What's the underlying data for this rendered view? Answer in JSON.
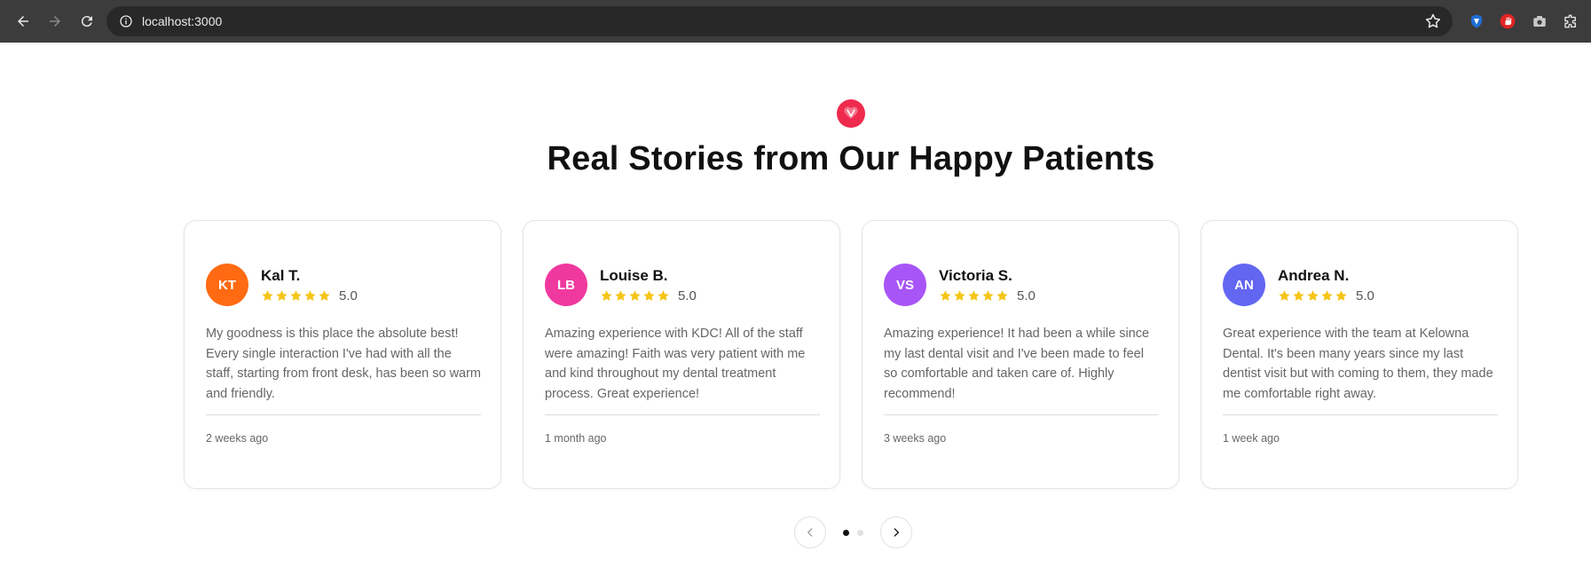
{
  "browser": {
    "url": "localhost:3000"
  },
  "section": {
    "heading": "Real Stories from Our Happy Patients",
    "accent_color": "#ef2b4d"
  },
  "reviews": [
    {
      "initials": "KT",
      "name": "Kal T.",
      "rating": 5,
      "score": "5.0",
      "avatar_color": "#ff6a13",
      "text": "My goodness is this place the absolute best! Every single interaction I've had with all the staff, starting from front desk, has been so warm and friendly.",
      "time": "2 weeks ago"
    },
    {
      "initials": "LB",
      "name": "Louise B.",
      "rating": 5,
      "score": "5.0",
      "avatar_color": "#f0399f",
      "text": "Amazing experience with KDC! All of the staff were amazing! Faith was very patient with me and kind throughout my dental treatment process. Great experience!",
      "time": "1 month ago"
    },
    {
      "initials": "VS",
      "name": "Victoria S.",
      "rating": 5,
      "score": "5.0",
      "avatar_color": "#a855f7",
      "text": "Amazing experience! It had been a while since my last dental visit and I've been made to feel so comfortable and taken care of. Highly recommend!",
      "time": "3 weeks ago"
    },
    {
      "initials": "AN",
      "name": "Andrea N.",
      "rating": 5,
      "score": "5.0",
      "avatar_color": "#6366f1",
      "text": "Great experience with the team at Kelowna Dental. It's been many years since my last dentist visit but with coming to them, they made me comfortable right away.",
      "time": "1 week ago"
    }
  ],
  "pager": {
    "pages": 2,
    "active_page": 1
  },
  "star_color": "#f5c518"
}
